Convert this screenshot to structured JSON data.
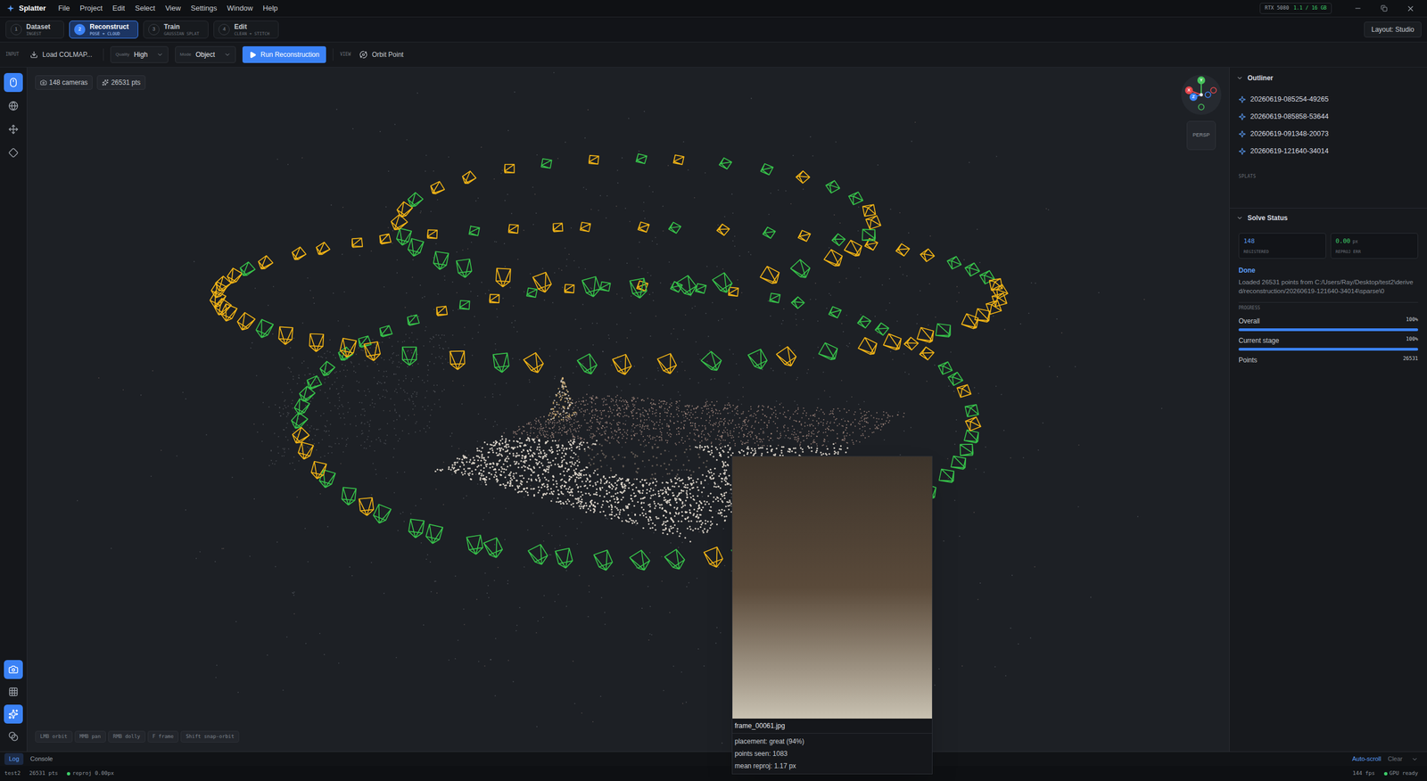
{
  "window": {
    "title": "Splatter",
    "menu": [
      "File",
      "Project",
      "Edit",
      "Select",
      "View",
      "Settings",
      "Window",
      "Help"
    ],
    "gpu_badge": {
      "name": "RTX 5080",
      "usage": "1.1 / 16 GB"
    }
  },
  "stages": [
    {
      "number": "1",
      "label": "Dataset",
      "sub": "INGEST",
      "selected": false
    },
    {
      "number": "2",
      "label": "Reconstruct",
      "sub": "POSE + CLOUD",
      "selected": true
    },
    {
      "number": "3",
      "label": "Train",
      "sub": "GAUSSIAN SPLAT",
      "selected": false
    },
    {
      "number": "4",
      "label": "Edit",
      "sub": "CLEAN + STITCH",
      "selected": false
    }
  ],
  "layout_button": "Layout: Studio",
  "toolbar": {
    "input_label": "INPUT",
    "load_button": "Load COLMAP...",
    "quality": {
      "label": "Quality",
      "value": "High"
    },
    "mode": {
      "label": "Mode",
      "value": "Object"
    },
    "run_button": "Run Reconstruction",
    "view_label": "VIEW",
    "orbit_button": "Orbit Point"
  },
  "left_tools": [
    {
      "kind": "select",
      "selected": true
    },
    {
      "kind": "globe",
      "selected": false
    },
    {
      "kind": "move",
      "selected": false
    },
    {
      "kind": "transform",
      "selected": false
    }
  ],
  "left_bottom_tools": [
    {
      "kind": "cameras",
      "selected": true
    },
    {
      "kind": "grid",
      "selected": false
    },
    {
      "kind": "points",
      "selected": true
    },
    {
      "kind": "splats",
      "selected": false
    }
  ],
  "viewport": {
    "chips": [
      {
        "kind": "cameras",
        "text": "148 cameras"
      },
      {
        "kind": "points",
        "text": "26531 pts"
      }
    ],
    "projection": "PERSP",
    "gizmo": [
      {
        "label": "X",
        "color": "#e5484d"
      },
      {
        "label": "Y",
        "color": "#46c35a"
      },
      {
        "label": "Z",
        "color": "#3b82f6"
      }
    ],
    "hints": [
      "LMB orbit",
      "MMB pan",
      "RMB dolly",
      "F frame",
      "Shift snap-orbit"
    ]
  },
  "hover_card": {
    "filename": "frame_00061.jpg",
    "lines": [
      "placement: great (94%)",
      "points seen: 1083",
      "mean reproj: 1.17 px"
    ]
  },
  "outliner": {
    "title": "Outliner",
    "items": [
      "20260619-085254-49265",
      "20260619-085858-53644",
      "20260619-091348-20073",
      "20260619-121640-34014"
    ],
    "section": "SPLATS"
  },
  "solve_status": {
    "title": "Solve Status",
    "stats": [
      {
        "value": "148",
        "unit": "",
        "label": "REGISTERED",
        "color": "#5b9cf5"
      },
      {
        "value": "0.00",
        "unit": "px",
        "label": "REPROJ ERR",
        "color": "#3ecf6a"
      }
    ],
    "state": "Done",
    "message": "Loaded 26531 points from C:/Users/Ray/Desktop/test2\\derived/reconstruction/20260619-121640-34014\\sparse\\0",
    "progress_label": "PROGRESS",
    "bars": [
      {
        "label": "Overall",
        "reading": "100%",
        "level": 1
      },
      {
        "label": "Current stage",
        "reading": "100%",
        "level": 1
      }
    ],
    "points": {
      "label": "Points",
      "value": "26531"
    }
  },
  "log_tabs": [
    {
      "label": "Log",
      "selected": true
    },
    {
      "label": "Console",
      "selected": false
    }
  ],
  "log_controls": {
    "autoscroll": "Auto-scroll",
    "autoscroll_on": true,
    "clear": "Clear"
  },
  "status_bar": {
    "project": "test2",
    "points": "26531 pts",
    "reproj": "reproj 0.00px",
    "fps": "144 fps",
    "gpu": "GPU ready"
  }
}
